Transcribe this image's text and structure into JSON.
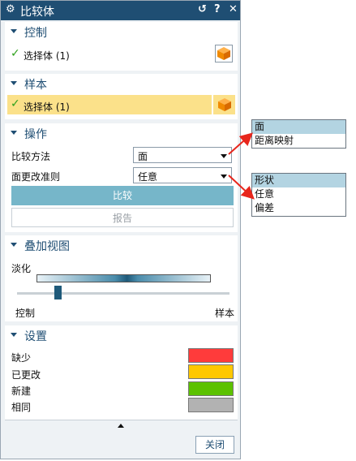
{
  "titlebar": {
    "title": "比较体",
    "app_icon": "gear-icon",
    "reset_icon": "↺",
    "help_icon": "?",
    "close_icon": "✕"
  },
  "panels": {
    "control": {
      "title": "控制",
      "select_label": "选择体 (1)"
    },
    "sample": {
      "title": "样本",
      "select_label": "选择体 (1)"
    },
    "operation": {
      "title": "操作",
      "compare_method_label": "比较方法",
      "compare_method_value": "面",
      "face_change_label": "面更改准则",
      "face_change_value": "任意",
      "compare_button": "比较",
      "report_button": "报告"
    },
    "overlay": {
      "title": "叠加视图",
      "fade_label": "淡化",
      "left_label": "控制",
      "right_label": "样本",
      "slider_value": 0.19
    },
    "settings": {
      "title": "设置",
      "rows": [
        {
          "label": "缺少",
          "color": "#ff3b3b"
        },
        {
          "label": "已更改",
          "color": "#ffc800"
        },
        {
          "label": "新建",
          "color": "#5cc100"
        },
        {
          "label": "相同",
          "color": "#b2b2b2"
        }
      ]
    }
  },
  "footer": {
    "close_button": "关闭"
  },
  "popups": {
    "method_options": [
      "面",
      "距离映射"
    ],
    "criteria_options": [
      "形状",
      "任意",
      "偏差"
    ]
  },
  "colors": {
    "title_bg": "#1f4e73",
    "selected_row": "#fbe18a",
    "primary_button": "#76b6c9",
    "arrow": "#e8261c"
  }
}
